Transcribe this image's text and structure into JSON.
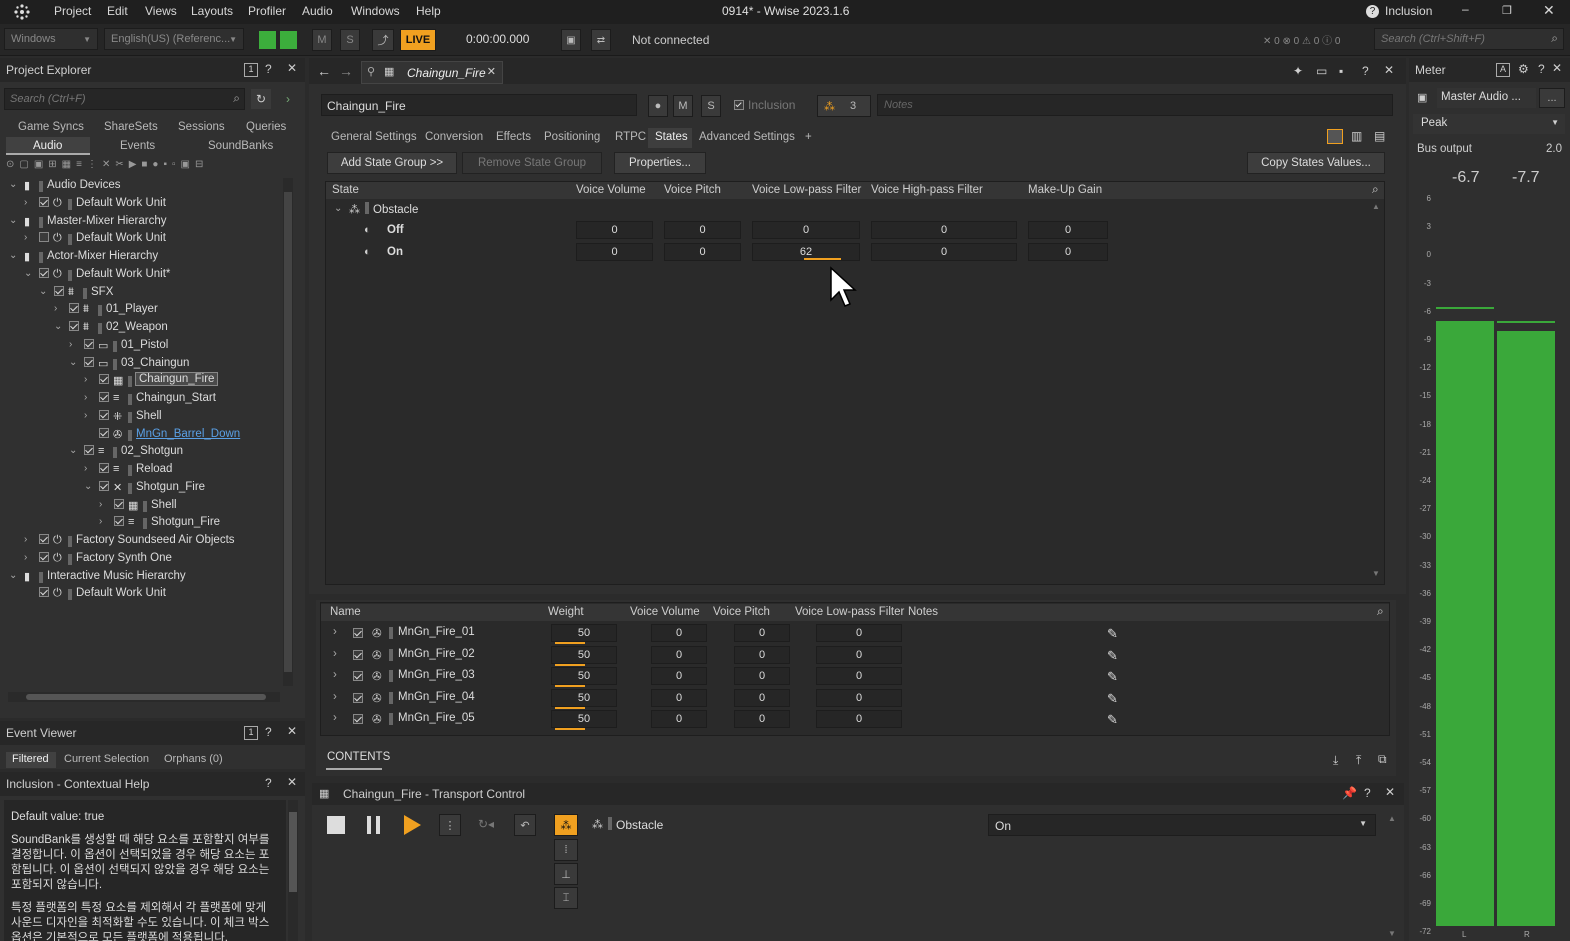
{
  "app": {
    "title": "0914* - Wwise 2023.1.6",
    "menu": [
      "Project",
      "Edit",
      "Views",
      "Layouts",
      "Profiler",
      "Audio",
      "Windows",
      "Help"
    ],
    "help_topic": "Inclusion"
  },
  "toolbar": {
    "layout": "Windows",
    "language": "English(US) (Referenc...",
    "m": "M",
    "s": "S",
    "live": "LIVE",
    "time": "0:00:00.000",
    "connection": "Not connected",
    "search_placeholder": "Search (Ctrl+Shift+F)",
    "counts": [
      "0",
      "0",
      "0",
      "0"
    ]
  },
  "project_explorer": {
    "title": "Project Explorer",
    "search_placeholder": "Search (Ctrl+F)",
    "tabs_row1": [
      "Game Syncs",
      "ShareSets",
      "Sessions",
      "Queries"
    ],
    "tabs_row2": [
      "Audio",
      "Events",
      "SoundBanks"
    ],
    "tree": [
      {
        "label": "Audio Devices",
        "depth": 0,
        "exp": "v",
        "kind": "folder"
      },
      {
        "label": "Default Work Unit",
        "depth": 1,
        "exp": ">",
        "kind": "wu",
        "cb": true
      },
      {
        "label": "Master-Mixer Hierarchy",
        "depth": 0,
        "exp": "v",
        "kind": "folder"
      },
      {
        "label": "Default Work Unit",
        "depth": 1,
        "exp": ">",
        "kind": "wu",
        "cb": false
      },
      {
        "label": "Actor-Mixer Hierarchy",
        "depth": 0,
        "exp": "v",
        "kind": "folder"
      },
      {
        "label": "Default Work Unit*",
        "depth": 1,
        "exp": "v",
        "kind": "wu",
        "cb": true
      },
      {
        "label": "SFX",
        "depth": 2,
        "exp": "v",
        "kind": "am",
        "cb": true
      },
      {
        "label": "01_Player",
        "depth": 3,
        "exp": ">",
        "kind": "am",
        "cb": true
      },
      {
        "label": "02_Weapon",
        "depth": 3,
        "exp": "v",
        "kind": "am",
        "cb": true
      },
      {
        "label": "01_Pistol",
        "depth": 4,
        "exp": ">",
        "kind": "vf",
        "cb": true
      },
      {
        "label": "03_Chaingun",
        "depth": 4,
        "exp": "v",
        "kind": "vf",
        "cb": true
      },
      {
        "label": "Chaingun_Fire",
        "depth": 5,
        "exp": ">",
        "kind": "blend",
        "cb": true,
        "selected": true
      },
      {
        "label": "Chaingun_Start",
        "depth": 5,
        "exp": ">",
        "kind": "seq",
        "cb": true
      },
      {
        "label": "Shell",
        "depth": 5,
        "exp": ">",
        "kind": "rand",
        "cb": true
      },
      {
        "label": "MnGn_Barrel_Down",
        "depth": 5,
        "exp": "",
        "kind": "sound",
        "cb": true,
        "link": true
      },
      {
        "label": "02_Shotgun",
        "depth": 4,
        "exp": "v",
        "kind": "seq",
        "cb": true
      },
      {
        "label": "Reload",
        "depth": 5,
        "exp": ">",
        "kind": "seq",
        "cb": true
      },
      {
        "label": "Shotgun_Fire",
        "depth": 5,
        "exp": "v",
        "kind": "sw",
        "cb": true
      },
      {
        "label": "Shell",
        "depth": 6,
        "exp": ">",
        "kind": "blend",
        "cb": true
      },
      {
        "label": "Shotgun_Fire",
        "depth": 6,
        "exp": ">",
        "kind": "seq",
        "cb": true
      },
      {
        "label": "Factory Soundseed Air Objects",
        "depth": 1,
        "exp": ">",
        "kind": "wu",
        "cb": true
      },
      {
        "label": "Factory Synth One",
        "depth": 1,
        "exp": ">",
        "kind": "wu",
        "cb": true
      },
      {
        "label": "Interactive Music Hierarchy",
        "depth": 0,
        "exp": "v",
        "kind": "folder"
      },
      {
        "label": "Default Work Unit",
        "depth": 1,
        "exp": "",
        "kind": "wu",
        "cb": true
      }
    ]
  },
  "event_viewer": {
    "title": "Event Viewer",
    "tabs": [
      "Filtered",
      "Current Selection",
      "Orphans (0)"
    ]
  },
  "help": {
    "title": "Inclusion - Contextual Help",
    "default": "Default value: true",
    "p1": "SoundBank를 생성할 때 해당 요소를 포함할지 여부를 결정합니다. 이 옵션이 선택되었을 경우 해당 요소는 포함됩니다. 이 옵션이 선택되지 않았을 경우 해당 요소는 포함되지 않습니다.",
    "p2": "특정 플랫폼의 특정 요소를 제외해서 각 플랫폼에 맞게 사운드 디자인을 최적화할 수도 있습니다. 이 체크 박스 옵션은 기본적으로 모든 플랫폼에 적용됩니다."
  },
  "editor": {
    "tab": "Chaingun_Fire",
    "name": "Chaingun_Fire",
    "m": "M",
    "s": "S",
    "inclusion": "Inclusion",
    "count": "3",
    "notes_placeholder": "Notes",
    "tabs": [
      "General Settings",
      "Conversion",
      "Effects",
      "Positioning",
      "RTPC",
      "States",
      "Advanced Settings",
      "+"
    ],
    "add_state": "Add State Group >>",
    "remove_state": "Remove State Group",
    "properties": "Properties...",
    "copy_states": "Copy States Values...",
    "columns": [
      "State",
      "Voice Volume",
      "Voice Pitch",
      "Voice Low-pass Filter",
      "Voice High-pass Filter",
      "Make-Up Gain"
    ],
    "group": "Obstacle",
    "states": [
      {
        "name": "Off",
        "values": [
          "0",
          "0",
          "0",
          "0",
          "0"
        ]
      },
      {
        "name": "On",
        "values": [
          "0",
          "0",
          "62",
          "0",
          "0"
        ]
      }
    ],
    "lpf_on": 62
  },
  "contents": {
    "columns": [
      "Name",
      "Weight",
      "Voice Volume",
      "Voice Pitch",
      "Voice Low-pass Filter",
      "Notes"
    ],
    "rows": [
      {
        "name": "MnGn_Fire_01",
        "weight": "50",
        "vol": "0",
        "pitch": "0",
        "lpf": "0"
      },
      {
        "name": "MnGn_Fire_02",
        "weight": "50",
        "vol": "0",
        "pitch": "0",
        "lpf": "0"
      },
      {
        "name": "MnGn_Fire_03",
        "weight": "50",
        "vol": "0",
        "pitch": "0",
        "lpf": "0"
      },
      {
        "name": "MnGn_Fire_04",
        "weight": "50",
        "vol": "0",
        "pitch": "0",
        "lpf": "0"
      },
      {
        "name": "MnGn_Fire_05",
        "weight": "50",
        "vol": "0",
        "pitch": "0",
        "lpf": "0"
      }
    ],
    "tab": "CONTENTS"
  },
  "transport": {
    "title": "Chaingun_Fire - Transport Control",
    "state_group": "Obstacle",
    "state_value": "On"
  },
  "meter": {
    "title": "Meter",
    "device": "Master Audio ...",
    "more": "...",
    "mode": "Peak",
    "bus": "Bus output",
    "bus_value": "2.0",
    "left": "-6.7",
    "right": "-7.7",
    "scale": [
      "6",
      "3",
      "0",
      "-3",
      "-6",
      "-9",
      "-12",
      "-15",
      "-18",
      "-21",
      "-24",
      "-27",
      "-30",
      "-33",
      "-36",
      "-39",
      "-42",
      "-45",
      "-48",
      "-51",
      "-54",
      "-57",
      "-60",
      "-63",
      "-66",
      "-69",
      "-72"
    ],
    "ch": [
      "L",
      "R"
    ],
    "level_left_db": -6.7,
    "level_right_db": -7.7
  }
}
